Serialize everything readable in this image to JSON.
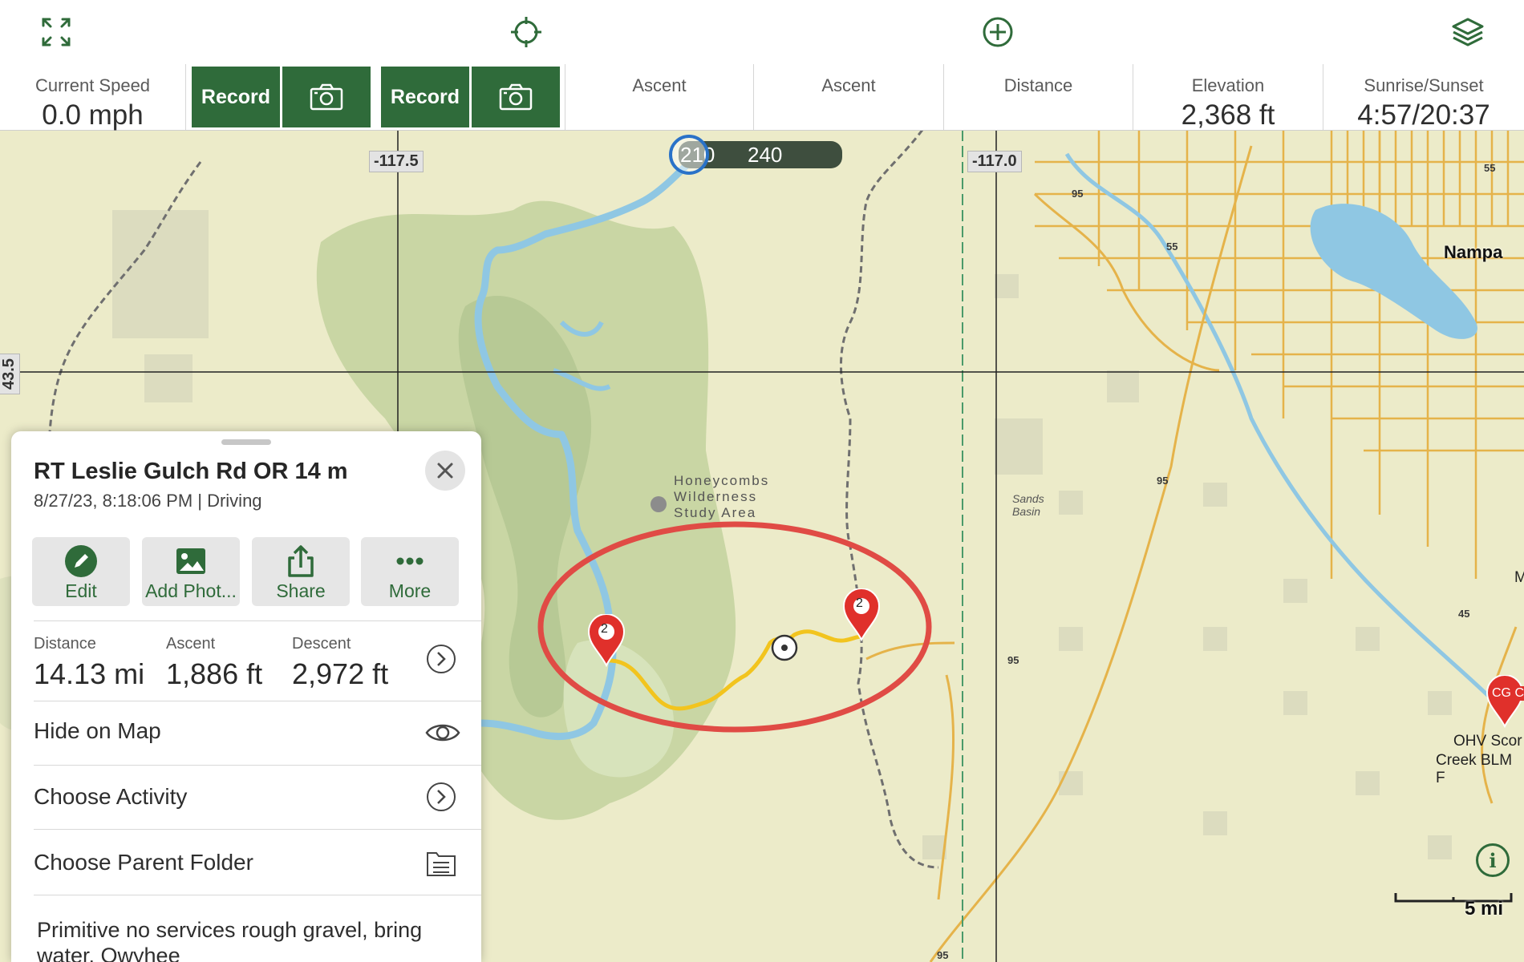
{
  "toolbar": {
    "icons": [
      "fullscreen-icon",
      "crosshair-icon",
      "add-icon",
      "layers-icon"
    ]
  },
  "stats": {
    "current_speed": {
      "label": "Current Speed",
      "value": "0.0 mph"
    },
    "record_label_1": "Record",
    "record_label_2": "Record",
    "ascent_1": {
      "label": "Ascent",
      "value": ""
    },
    "ascent_2": {
      "label": "Ascent",
      "value": ""
    },
    "distance": {
      "label": "Distance",
      "value": ""
    },
    "elevation": {
      "label": "Elevation",
      "value": "2,368 ft"
    },
    "sunrise_sunset": {
      "label": "Sunrise/Sunset",
      "value": "4:57/20:37"
    }
  },
  "map": {
    "grid_labels": {
      "lon_1": "-117.5",
      "lon_2": "-117.0",
      "lat_1": "43.5"
    },
    "ruler": {
      "a": "210",
      "b": "240"
    },
    "place_names": {
      "nampa": "Nampa",
      "honeycombs": "Honeycombs Wilderness Study Area",
      "sands_basin": "Sands Basin",
      "ohv": "OHV Scor",
      "ohv_2": "Creek BLM F",
      "cg": "CG C",
      "edge_letter": "M"
    },
    "road_numbers": [
      "95",
      "55",
      "95",
      "95",
      "45",
      "95",
      "55"
    ],
    "scale_label": "5 mi",
    "waypoint_badge": "2",
    "accent_red": "#e0302b",
    "track_color": "#f2c41e",
    "highlight_circle": "#e04b45"
  },
  "sheet": {
    "title": "RT Leslie Gulch Rd OR 14 m",
    "subtitle": "8/27/23, 8:18:06 PM | Driving",
    "actions": [
      {
        "label": "Edit",
        "icon": "pencil-icon"
      },
      {
        "label": "Add Phot...",
        "icon": "image-icon"
      },
      {
        "label": "Share",
        "icon": "share-icon"
      },
      {
        "label": "More",
        "icon": "more-icon"
      }
    ],
    "metrics": {
      "distance": {
        "label": "Distance",
        "value": "14.13 mi"
      },
      "ascent": {
        "label": "Ascent",
        "value": "1,886 ft"
      },
      "descent": {
        "label": "Descent",
        "value": "2,972 ft"
      }
    },
    "rows": {
      "hide": "Hide on Map",
      "activity": "Choose Activity",
      "folder": "Choose Parent Folder"
    },
    "notes": "Primitive no services rough gravel, bring water. Owyhee"
  },
  "colors": {
    "brand_green": "#2f6b3a"
  }
}
